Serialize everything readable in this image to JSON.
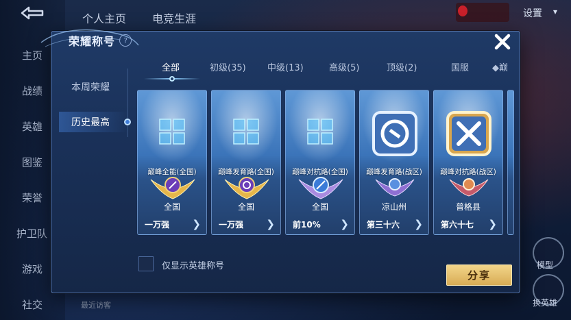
{
  "background": {
    "back_icon": "back-arrow-icon",
    "top_tabs": [
      "个人主页",
      "电竞生涯"
    ],
    "settings_label": "设置",
    "nav_items": [
      "主页",
      "战绩",
      "英雄",
      "图鉴",
      "荣誉",
      "护卫队",
      "游戏",
      "社交"
    ],
    "recent_visitors_label": "最近访客",
    "right_labels": [
      "模型",
      "换英雄"
    ]
  },
  "dialog": {
    "title": "荣耀称号",
    "help_glyph": "?",
    "side_tabs": [
      "本周荣耀",
      "历史最高"
    ],
    "active_side_tab": "历史最高",
    "category_tabs": [
      "全部",
      "初级(35)",
      "中级(13)",
      "高级(5)",
      "顶级(2)",
      "国服",
      "巅"
    ],
    "active_category": "全部",
    "cards": [
      {
        "name": "巅峰全能(全国)",
        "region": "全国",
        "rank": "一万强",
        "icon": "tiles-icon"
      },
      {
        "name": "巅峰发育路(全国)",
        "region": "全国",
        "rank": "一万强",
        "icon": "tiles-icon"
      },
      {
        "name": "巅峰对抗路(全国)",
        "region": "全国",
        "rank": "前10%",
        "icon": "tiles-icon"
      },
      {
        "name": "巅峰发育路(战区)",
        "region": "凉山州",
        "rank": "第三十六",
        "icon": "lane-badge-icon"
      },
      {
        "name": "巅峰对抗路(战区)",
        "region": "普格县",
        "rank": "第六十七",
        "icon": "crossed-swords-icon"
      }
    ],
    "hero_title_only_label": "仅显示英雄称号",
    "share_label": "分享"
  },
  "colors": {
    "accent": "#8fd0ff",
    "share_button": "#e4bf6a",
    "dialog_bg": "#1a3159"
  }
}
